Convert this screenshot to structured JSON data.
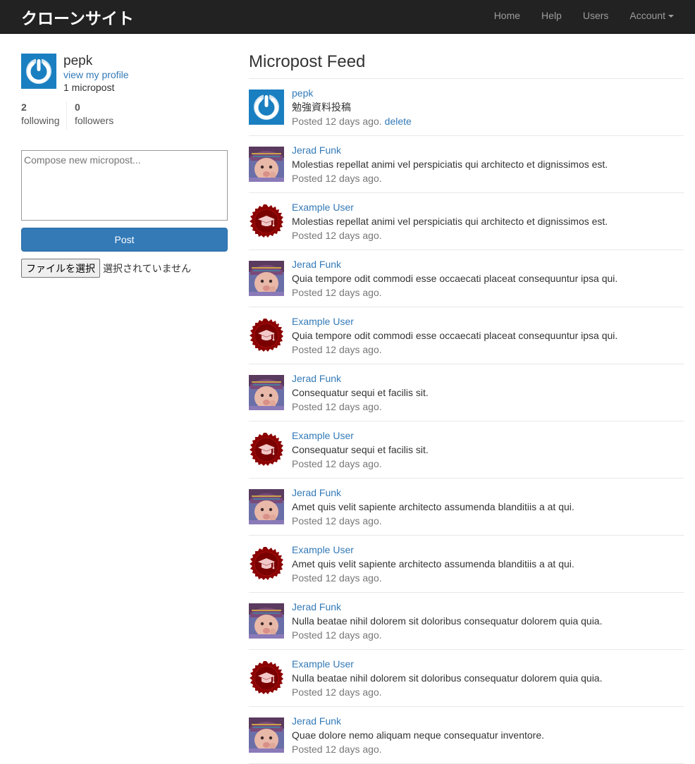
{
  "brand": "クローンサイト",
  "nav": {
    "home": "Home",
    "help": "Help",
    "users": "Users",
    "account": "Account"
  },
  "sidebar": {
    "user_name": "pepk",
    "view_profile": "view my profile",
    "micropost_count": "1 micropost",
    "following_count": "2",
    "following_label": "following",
    "followers_count": "0",
    "followers_label": "followers",
    "compose_placeholder": "Compose new micropost...",
    "post_button": "Post",
    "file_button": "ファイルを選択",
    "file_status": "選択されていません"
  },
  "feed": {
    "title": "Micropost Feed",
    "delete_label": "delete",
    "posts": [
      {
        "user": "pepk",
        "content": "勉強資料投稿",
        "time": "Posted 12 days ago.",
        "avatar": "power-blue",
        "deletable": true
      },
      {
        "user": "Jerad Funk",
        "content": "Molestias repellat animi vel perspiciatis qui architecto et dignissimos est.",
        "time": "Posted 12 days ago.",
        "avatar": "child-photo",
        "deletable": false
      },
      {
        "user": "Example User",
        "content": "Molestias repellat animi vel perspiciatis qui architecto et dignissimos est.",
        "time": "Posted 12 days ago.",
        "avatar": "grad-badge",
        "deletable": false
      },
      {
        "user": "Jerad Funk",
        "content": "Quia tempore odit commodi esse occaecati placeat consequuntur ipsa qui.",
        "time": "Posted 12 days ago.",
        "avatar": "child-photo",
        "deletable": false
      },
      {
        "user": "Example User",
        "content": "Quia tempore odit commodi esse occaecati placeat consequuntur ipsa qui.",
        "time": "Posted 12 days ago.",
        "avatar": "grad-badge",
        "deletable": false
      },
      {
        "user": "Jerad Funk",
        "content": "Consequatur sequi et facilis sit.",
        "time": "Posted 12 days ago.",
        "avatar": "child-photo",
        "deletable": false
      },
      {
        "user": "Example User",
        "content": "Consequatur sequi et facilis sit.",
        "time": "Posted 12 days ago.",
        "avatar": "grad-badge",
        "deletable": false
      },
      {
        "user": "Jerad Funk",
        "content": "Amet quis velit sapiente architecto assumenda blanditiis a at qui.",
        "time": "Posted 12 days ago.",
        "avatar": "child-photo",
        "deletable": false
      },
      {
        "user": "Example User",
        "content": "Amet quis velit sapiente architecto assumenda blanditiis a at qui.",
        "time": "Posted 12 days ago.",
        "avatar": "grad-badge",
        "deletable": false
      },
      {
        "user": "Jerad Funk",
        "content": "Nulla beatae nihil dolorem sit doloribus consequatur dolorem quia quia.",
        "time": "Posted 12 days ago.",
        "avatar": "child-photo",
        "deletable": false
      },
      {
        "user": "Example User",
        "content": "Nulla beatae nihil dolorem sit doloribus consequatur dolorem quia quia.",
        "time": "Posted 12 days ago.",
        "avatar": "grad-badge",
        "deletable": false
      },
      {
        "user": "Jerad Funk",
        "content": "Quae dolore nemo aliquam neque consequatur inventore.",
        "time": "Posted 12 days ago.",
        "avatar": "child-photo",
        "deletable": false
      }
    ]
  },
  "colors": {
    "navbar": "#222222",
    "link": "#337ab7",
    "primary_button": "#337ab7",
    "badge_red": "#8b0000",
    "avatar_blue": "#1a7fc1"
  }
}
